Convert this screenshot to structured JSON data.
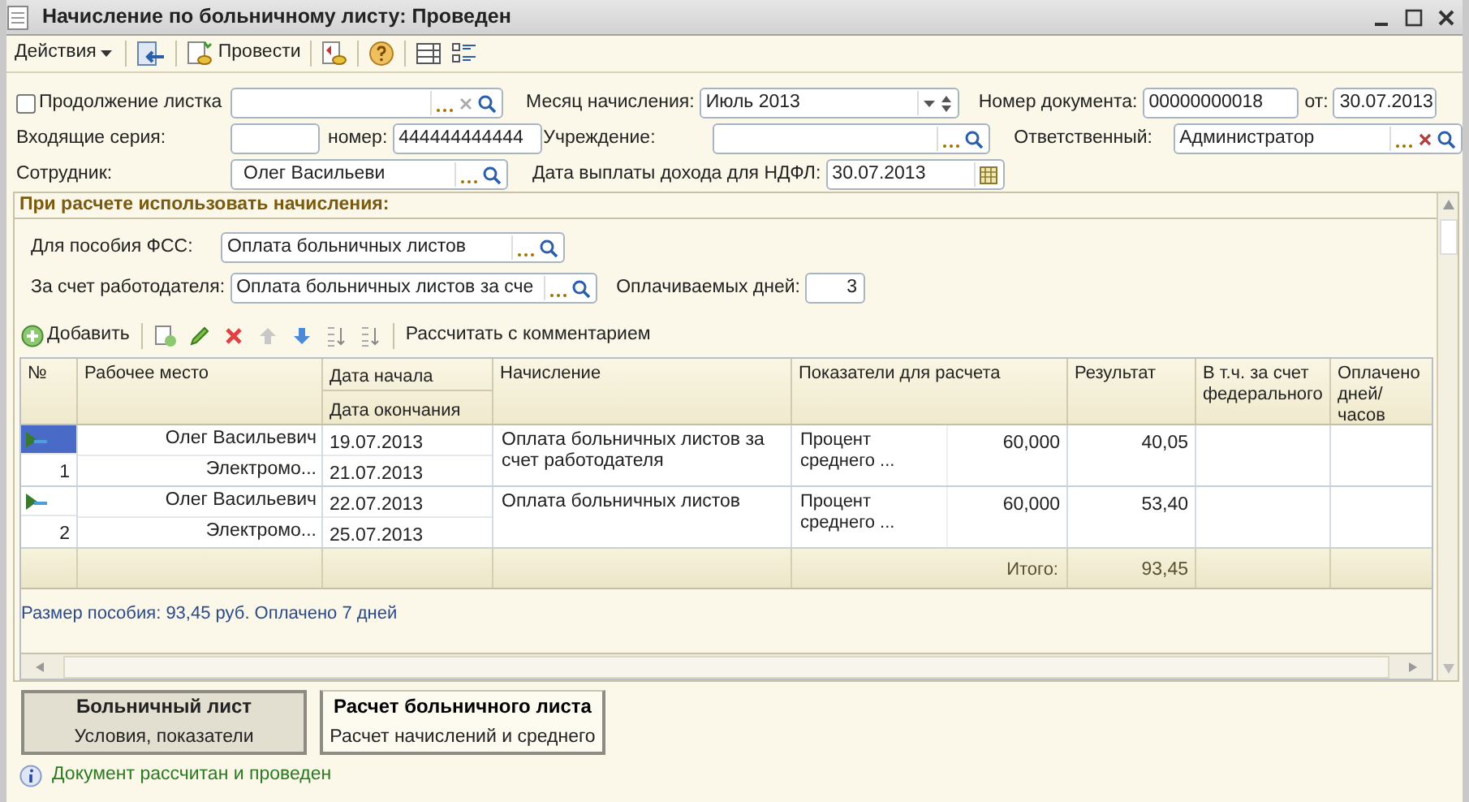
{
  "window": {
    "title": "Начисление по больничному листу: Проведен"
  },
  "toolbar": {
    "actions_menu": "Действия",
    "post_button": "Провести"
  },
  "form": {
    "continuation": {
      "label": "Продолжение листка",
      "checked": false
    },
    "month": {
      "label": "Месяц начисления:",
      "value": "Июль 2013"
    },
    "doc_number": {
      "label": "Номер документа:",
      "value": "00000000018"
    },
    "doc_date": {
      "label": "от:",
      "value": "30.07.2013"
    },
    "series": {
      "label": "Входящие серия:"
    },
    "number": {
      "label": "номер:",
      "value": "444444444444"
    },
    "institution": {
      "label": "Учреждение:"
    },
    "responsible": {
      "label": "Ответственный:",
      "value": "Администратор"
    },
    "employee": {
      "label": "Сотрудник:",
      "value": "Олег Васильеви"
    },
    "payout_date": {
      "label": "Дата выплаты дохода для НДФЛ:",
      "value": "30.07.2013"
    }
  },
  "calc": {
    "heading": "При расчете использовать начисления:",
    "fss": {
      "label": "Для пособия ФСС:",
      "value": "Оплата больничных листов"
    },
    "employer": {
      "label": "За счет работодателя:",
      "value": "Оплата больничных листов за сче"
    },
    "paid_days": {
      "label": "Оплачиваемых дней:",
      "value": "3"
    }
  },
  "table_toolbar": {
    "add_button": "Добавить",
    "calc_button": "Рассчитать с комментарием"
  },
  "table": {
    "columns": [
      "№",
      "Рабочее место",
      "Дата начала",
      "Дата окончания",
      "Начисление",
      "Показатели для расчета",
      "Результат",
      "В т.ч. за счет федерального",
      "Оплачено дней/часов"
    ],
    "rows": [
      {
        "number": "1",
        "selected": true,
        "name": "Олег Васильевич",
        "position": "Электромо...",
        "date_start": "19.07.2013",
        "date_end": "21.07.2013",
        "accrual": "Оплата больничных листов за счет работодателя",
        "indicator": "Процент среднего ...",
        "indicator_value": "60,000",
        "result": "40,05"
      },
      {
        "number": "2",
        "selected": false,
        "name": "Олег Васильевич",
        "position": "Электромо...",
        "date_start": "22.07.2013",
        "date_end": "25.07.2013",
        "accrual": "Оплата больничных листов",
        "indicator": "Процент среднего ...",
        "indicator_value": "60,000",
        "result": "53,40"
      }
    ],
    "totals": {
      "label": "Итого:",
      "value": "93,45"
    }
  },
  "summary": "Размер пособия: 93,45 руб. Оплачено 7 дней",
  "tabs": [
    {
      "title": "Больничный лист",
      "subtitle": "Условия, показатели",
      "selected": false
    },
    {
      "title": "Расчет больничного листа",
      "subtitle": "Расчет начислений и среднего",
      "selected": true
    }
  ],
  "status": "Документ рассчитан и проведен"
}
